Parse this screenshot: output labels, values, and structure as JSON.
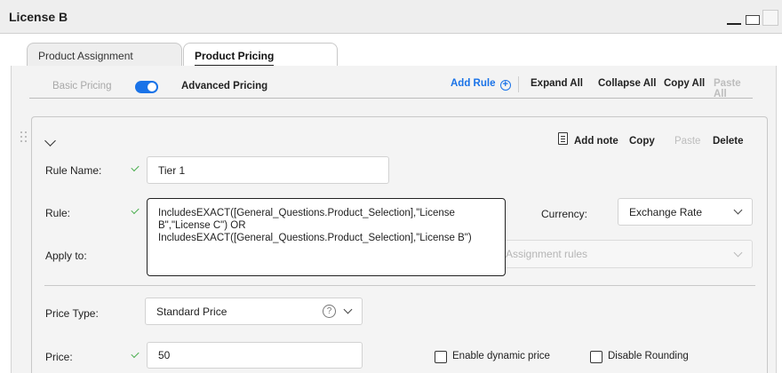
{
  "window": {
    "title": "License B"
  },
  "tabs": [
    {
      "label": "Product Assignment",
      "active": false
    },
    {
      "label": "Product Pricing",
      "active": true
    }
  ],
  "pricing_mode": {
    "basic_label": "Basic Pricing",
    "advanced_label": "Advanced Pricing",
    "advanced_enabled": true,
    "toggle_color": "#1a73e8"
  },
  "top_actions": {
    "add_rule": "Add Rule",
    "expand_all": "Expand All",
    "collapse_all": "Collapse All",
    "copy_all": "Copy All",
    "paste_all": "Paste All"
  },
  "rule_card": {
    "actions": {
      "add_note": "Add note",
      "copy": "Copy",
      "paste": "Paste",
      "delete": "Delete"
    },
    "rule_name": {
      "label": "Rule Name:",
      "value": "Tier 1"
    },
    "rule": {
      "label": "Rule:",
      "value": "IncludesEXACT([General_Questions.Product_Selection],\"License B\",\"License C\") OR IncludesEXACT([General_Questions.Product_Selection],\"License B\")"
    },
    "currency": {
      "label": "Currency:",
      "value": "Exchange Rate"
    },
    "apply_to": {
      "label": "Apply to:",
      "value": "Assignment rules"
    },
    "price_type": {
      "label": "Price Type:",
      "value": "Standard Price"
    },
    "price": {
      "label": "Price:",
      "value": "50"
    },
    "enable_dynamic_price": {
      "label": "Enable dynamic price",
      "checked": false
    },
    "disable_rounding": {
      "label": "Disable Rounding",
      "checked": false
    }
  },
  "colors": {
    "accent": "#1a73e8",
    "valid_check": "#4caf50",
    "disabled_text": "#bdbdbd"
  }
}
